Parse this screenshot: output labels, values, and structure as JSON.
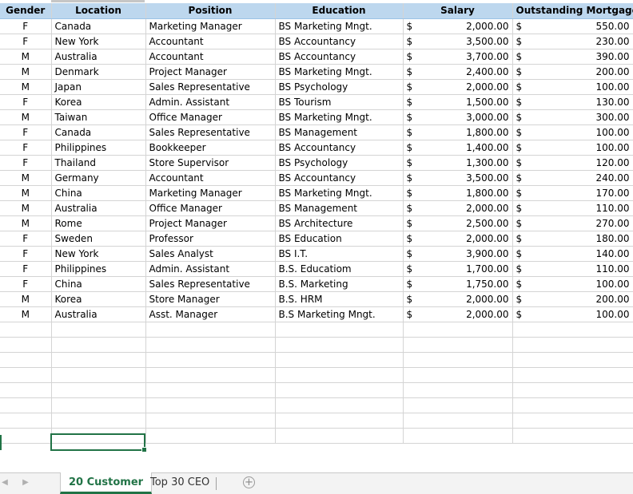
{
  "headers": {
    "gender": "Gender",
    "location": "Location",
    "position": "Position",
    "education": "Education",
    "salary": "Salary",
    "mortgage": "Outstanding Mortgage"
  },
  "currency_symbol": "$",
  "rows": [
    {
      "gender": "F",
      "location": "Canada",
      "position": "Marketing Manager",
      "education": "BS Marketing Mngt.",
      "salary": "2,000.00",
      "mortgage": "550.00"
    },
    {
      "gender": "F",
      "location": "New York",
      "position": "Accountant",
      "education": "BS Accountancy",
      "salary": "3,500.00",
      "mortgage": "230.00"
    },
    {
      "gender": "M",
      "location": "Australia",
      "position": "Accountant",
      "education": "BS Accountancy",
      "salary": "3,700.00",
      "mortgage": "390.00"
    },
    {
      "gender": "M",
      "location": "Denmark",
      "position": "Project Manager",
      "education": "BS Marketing Mngt.",
      "salary": "2,400.00",
      "mortgage": "200.00"
    },
    {
      "gender": "M",
      "location": "Japan",
      "position": "Sales Representative",
      "education": "BS Psychology",
      "salary": "2,000.00",
      "mortgage": "100.00"
    },
    {
      "gender": "F",
      "location": "Korea",
      "position": "Admin. Assistant",
      "education": "BS Tourism",
      "salary": "1,500.00",
      "mortgage": "130.00"
    },
    {
      "gender": "M",
      "location": "Taiwan",
      "position": "Office Manager",
      "education": "BS Marketing Mngt.",
      "salary": "3,000.00",
      "mortgage": "300.00"
    },
    {
      "gender": "F",
      "location": "Canada",
      "position": "Sales Representative",
      "education": "BS Management",
      "salary": "1,800.00",
      "mortgage": "100.00"
    },
    {
      "gender": "F",
      "location": "Philippines",
      "position": "Bookkeeper",
      "education": "BS Accountancy",
      "salary": "1,400.00",
      "mortgage": "100.00"
    },
    {
      "gender": "F",
      "location": "Thailand",
      "position": "Store Supervisor",
      "education": "BS Psychology",
      "salary": "1,300.00",
      "mortgage": "120.00"
    },
    {
      "gender": "M",
      "location": "Germany",
      "position": "Accountant",
      "education": "BS Accountancy",
      "salary": "3,500.00",
      "mortgage": "240.00"
    },
    {
      "gender": "M",
      "location": "China",
      "position": "Marketing Manager",
      "education": "BS Marketing Mngt.",
      "salary": "1,800.00",
      "mortgage": "170.00"
    },
    {
      "gender": "M",
      "location": "Australia",
      "position": "Office Manager",
      "education": "BS Management",
      "salary": "2,000.00",
      "mortgage": "110.00"
    },
    {
      "gender": "M",
      "location": "Rome",
      "position": "Project Manager",
      "education": "BS Architecture",
      "salary": "2,500.00",
      "mortgage": "270.00"
    },
    {
      "gender": "F",
      "location": "Sweden",
      "position": "Professor",
      "education": "BS Education",
      "salary": "2,000.00",
      "mortgage": "180.00"
    },
    {
      "gender": "F",
      "location": "New York",
      "position": "Sales Analyst",
      "education": "BS I.T.",
      "salary": "3,900.00",
      "mortgage": "140.00"
    },
    {
      "gender": "F",
      "location": "Philippines",
      "position": "Admin. Assistant",
      "education": "B.S. Educatiom",
      "salary": "1,700.00",
      "mortgage": "110.00"
    },
    {
      "gender": "F",
      "location": "China",
      "position": "Sales Representative",
      "education": "B.S. Marketing",
      "salary": "1,750.00",
      "mortgage": "100.00"
    },
    {
      "gender": "M",
      "location": "Korea",
      "position": "Store Manager",
      "education": "B.S. HRM",
      "salary": "2,000.00",
      "mortgage": "200.00"
    },
    {
      "gender": "M",
      "location": "Australia",
      "position": "Asst. Manager",
      "education": "B.S Marketing Mngt.",
      "salary": "2,000.00",
      "mortgage": "100.00"
    }
  ],
  "tabs": {
    "sheet1": "20 Customer",
    "sheet2": "Top 30 CEO",
    "add": "+"
  },
  "icons": {
    "prev": "scroll-left-arrow",
    "next": "scroll-right-arrow"
  },
  "colors": {
    "header_fill": "#bdd7ee",
    "accent": "#217346",
    "gridline": "#d4d4d4"
  }
}
